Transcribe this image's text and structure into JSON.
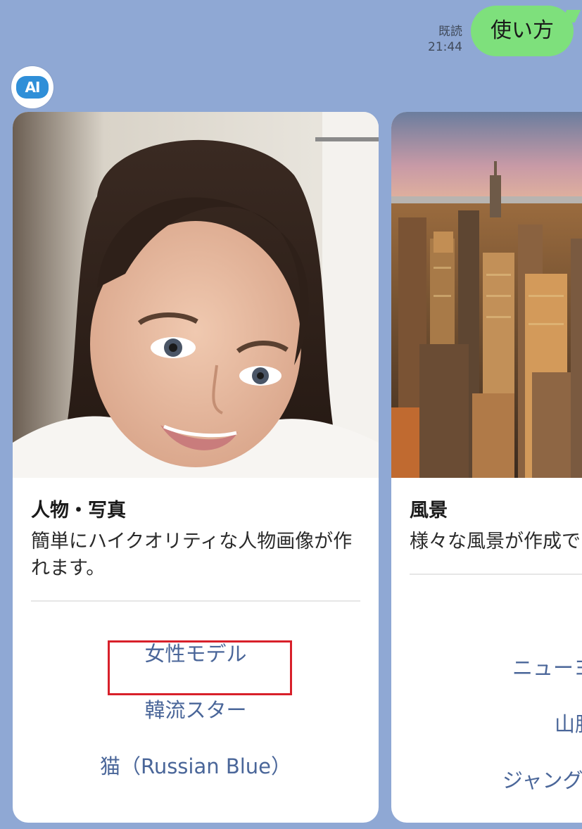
{
  "message": {
    "read_status": "既読",
    "time": "21:44",
    "text": "使い方"
  },
  "bot": {
    "avatar_text": "AI"
  },
  "cards": [
    {
      "title": "人物・写真",
      "description": "簡単にハイクオリティな人物画像が作れます。",
      "image_alt": "smiling woman portrait",
      "actions": [
        "女性モデル",
        "韓流スター",
        "猫（Russian Blue）"
      ]
    },
    {
      "title": "風景",
      "description": "様々な風景が作成で",
      "image_alt": "city skyline",
      "actions": [
        "ニューヨ",
        "山脈",
        "ジャング"
      ]
    }
  ],
  "colors": {
    "background": "#8fa8d4",
    "bubble": "#7ee07c",
    "action_link": "#4a6699",
    "highlight": "#d8202a"
  }
}
